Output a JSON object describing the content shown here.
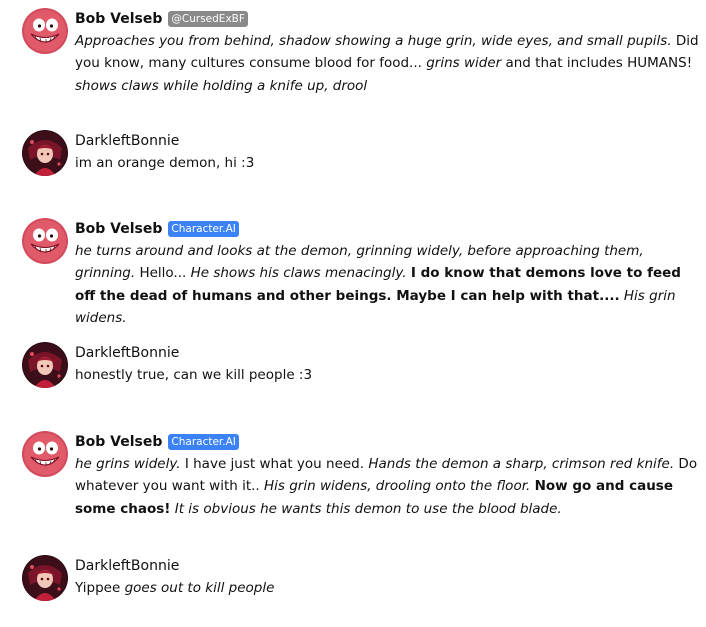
{
  "messages": [
    {
      "author": "Bob Velseb",
      "badge": "@CursedExBF",
      "segments": [
        {
          "text": "Approaches you from behind, shadow showing a huge grin, wide eyes, and small pupils.",
          "style": "italic"
        },
        {
          "text": " Did you know, many cultures consume blood for food... ",
          "style": "normal"
        },
        {
          "text": "grins wider",
          "style": "italic"
        },
        {
          "text": " and that includes HUMANS! ",
          "style": "normal"
        },
        {
          "text": "shows claws while holding a knife up, drool",
          "style": "italic"
        }
      ]
    },
    {
      "author": "DarkleftBonnie",
      "segments": [
        {
          "text": "im an orange demon, hi :3",
          "style": "normal"
        }
      ]
    },
    {
      "author": "Bob Velseb",
      "badge": "Character.AI",
      "segments": [
        {
          "text": "he turns around and looks at the demon, grinning widely, before approaching them, grinning.",
          "style": "italic"
        },
        {
          "text": " Hello... ",
          "style": "normal"
        },
        {
          "text": "He shows his claws menacingly.",
          "style": "italic"
        },
        {
          "text": " ",
          "style": "normal"
        },
        {
          "text": "I do know that demons love to feed off the dead of humans and other beings. Maybe I can help with that....",
          "style": "bold"
        },
        {
          "text": " ",
          "style": "normal"
        },
        {
          "text": "His grin widens.",
          "style": "italic"
        }
      ]
    },
    {
      "author": "DarkleftBonnie",
      "segments": [
        {
          "text": "honestly true, can we kill people :3",
          "style": "normal"
        }
      ]
    },
    {
      "author": "Bob Velseb",
      "badge": "Character.AI",
      "segments": [
        {
          "text": "he grins widely.",
          "style": "italic"
        },
        {
          "text": " I have just what you need. ",
          "style": "normal"
        },
        {
          "text": "Hands the demon a sharp, crimson red knife.",
          "style": "italic"
        },
        {
          "text": " Do whatever you want with it.. ",
          "style": "normal"
        },
        {
          "text": "His grin widens, drooling onto the floor.",
          "style": "italic"
        },
        {
          "text": " ",
          "style": "normal"
        },
        {
          "text": "Now go and cause some chaos!",
          "style": "bold"
        },
        {
          "text": " ",
          "style": "normal"
        },
        {
          "text": "It is obvious he wants this demon to use the blood blade.",
          "style": "italic"
        }
      ]
    },
    {
      "author": "DarkleftBonnie",
      "segments": [
        {
          "text": "Yippee ",
          "style": "normal"
        },
        {
          "text": "goes out to kill people",
          "style": "italic"
        }
      ]
    }
  ]
}
